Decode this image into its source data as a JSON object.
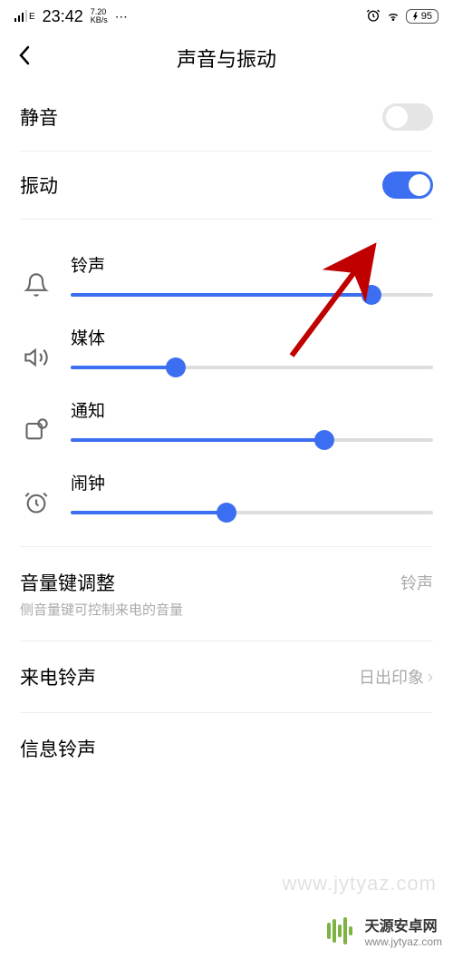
{
  "status": {
    "signal_label": "E",
    "time": "23:42",
    "speed_top": "7.20",
    "speed_unit": "KB/s",
    "battery": "95"
  },
  "header": {
    "title": "声音与振动"
  },
  "toggles": {
    "mute": {
      "label": "静音",
      "on": false
    },
    "vibrate": {
      "label": "振动",
      "on": true
    }
  },
  "sliders": {
    "ringtone": {
      "label": "铃声",
      "value": 83
    },
    "media": {
      "label": "媒体",
      "value": 29
    },
    "notification": {
      "label": "通知",
      "value": 70
    },
    "alarm": {
      "label": "闹钟",
      "value": 43
    }
  },
  "volumekey": {
    "title": "音量键调整",
    "sub": "侧音量键可控制来电的音量",
    "value": "铃声"
  },
  "ringtone_item": {
    "title": "来电铃声",
    "value": "日出印象"
  },
  "message_item": {
    "title": "信息铃声"
  },
  "watermark": {
    "title": "天源安卓网",
    "url": "www.jytyaz.com"
  }
}
